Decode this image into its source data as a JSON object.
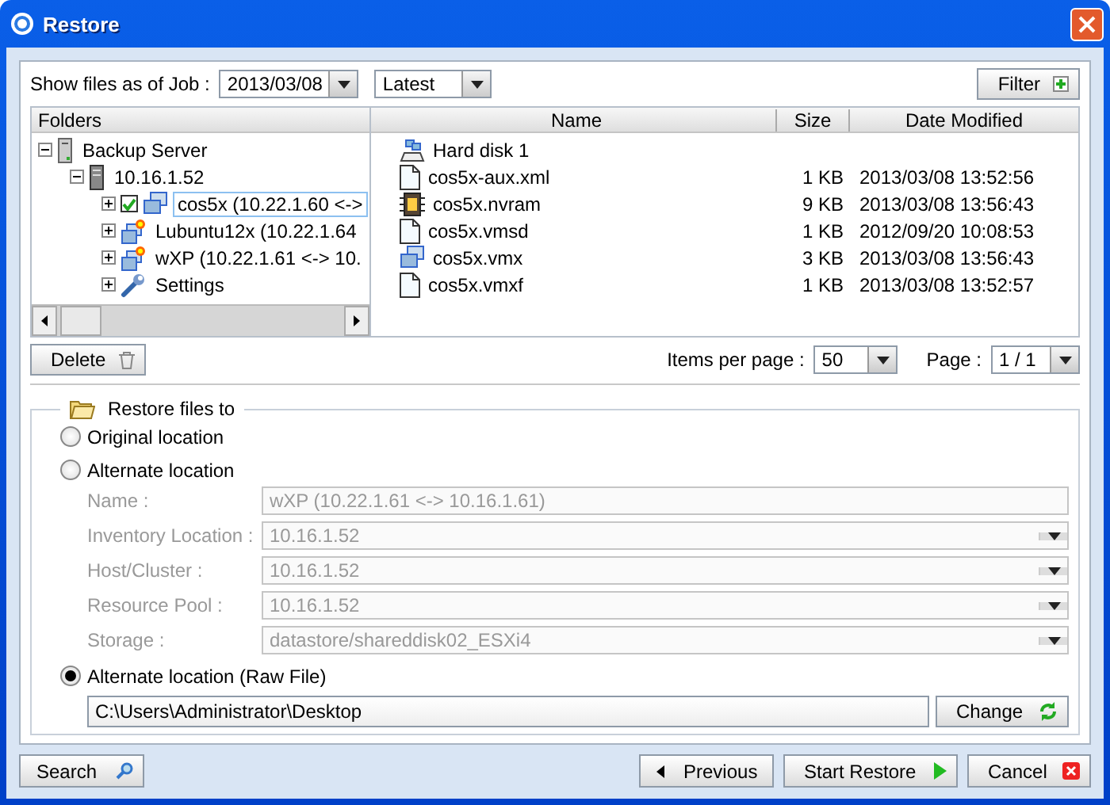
{
  "window": {
    "title": "Restore"
  },
  "job": {
    "label": "Show files as of Job :",
    "date": "2013/03/08",
    "version": "Latest"
  },
  "filter_button": "Filter",
  "folders": {
    "heading": "Folders",
    "tree": [
      {
        "label": "Backup Server",
        "kind": "server",
        "expanded": true,
        "checked": false,
        "selected": false,
        "children": [
          {
            "label": "10.16.1.52",
            "kind": "host",
            "expanded": true,
            "checked": false,
            "selected": false,
            "children": [
              {
                "label": "cos5x (10.22.1.60 <->",
                "kind": "vm",
                "expanded": false,
                "checked": true,
                "selected": true
              },
              {
                "label": "Lubuntu12x (10.22.1.64",
                "kind": "vm-new",
                "expanded": false,
                "checked": false,
                "selected": false
              },
              {
                "label": "wXP  (10.22.1.61 <-> 10.",
                "kind": "vm-new",
                "expanded": false,
                "checked": false,
                "selected": false
              },
              {
                "label": "Settings",
                "kind": "settings",
                "expanded": false,
                "checked": false,
                "selected": false
              }
            ]
          }
        ]
      }
    ]
  },
  "files": {
    "columns": [
      "Name",
      "Size",
      "Date Modified"
    ],
    "rows": [
      {
        "kind": "disk",
        "name": "Hard disk 1"
      },
      {
        "kind": "file",
        "name": "cos5x-aux.xml",
        "size": "1 KB",
        "date": "2013/03/08 13:52:56"
      },
      {
        "kind": "nvram",
        "name": "cos5x.nvram",
        "size": "9 KB",
        "date": "2013/03/08 13:56:43"
      },
      {
        "kind": "file",
        "name": "cos5x.vmsd",
        "size": "1 KB",
        "date": "2012/09/20 10:08:53"
      },
      {
        "kind": "vm",
        "name": "cos5x.vmx",
        "size": "3 KB",
        "date": "2013/03/08 13:56:43"
      },
      {
        "kind": "file",
        "name": "cos5x.vmxf",
        "size": "1 KB",
        "date": "2013/03/08 13:52:57"
      }
    ]
  },
  "delete_button": "Delete",
  "paging": {
    "items_label": "Items per page :",
    "items_value": "50",
    "page_label": "Page :",
    "page_value": "1 / 1"
  },
  "restore": {
    "legend": "Restore files to",
    "options": [
      {
        "label": "Original location",
        "selected": false
      },
      {
        "label": "Alternate location",
        "selected": false
      }
    ],
    "fields": [
      {
        "kind": "text",
        "label": "Name :",
        "value": "wXP  (10.22.1.61 <-> 10.16.1.61)",
        "disabled": true
      },
      {
        "kind": "combo",
        "label": "Inventory Location :",
        "value": "10.16.1.52",
        "disabled": true
      },
      {
        "kind": "combo",
        "label": "Host/Cluster :",
        "value": "10.16.1.52",
        "disabled": true
      },
      {
        "kind": "combo",
        "label": "Resource Pool :",
        "value": "10.16.1.52",
        "disabled": true
      },
      {
        "kind": "combo",
        "label": "Storage :",
        "value": "datastore/shareddisk02_ESXi4",
        "disabled": true
      }
    ],
    "raw_option": {
      "label": "Alternate location (Raw File)",
      "selected": true
    },
    "path": "C:\\Users\\Administrator\\Desktop",
    "change_button": "Change"
  },
  "footer": {
    "search": "Search",
    "previous": "Previous",
    "start": "Start Restore",
    "cancel": "Cancel"
  }
}
